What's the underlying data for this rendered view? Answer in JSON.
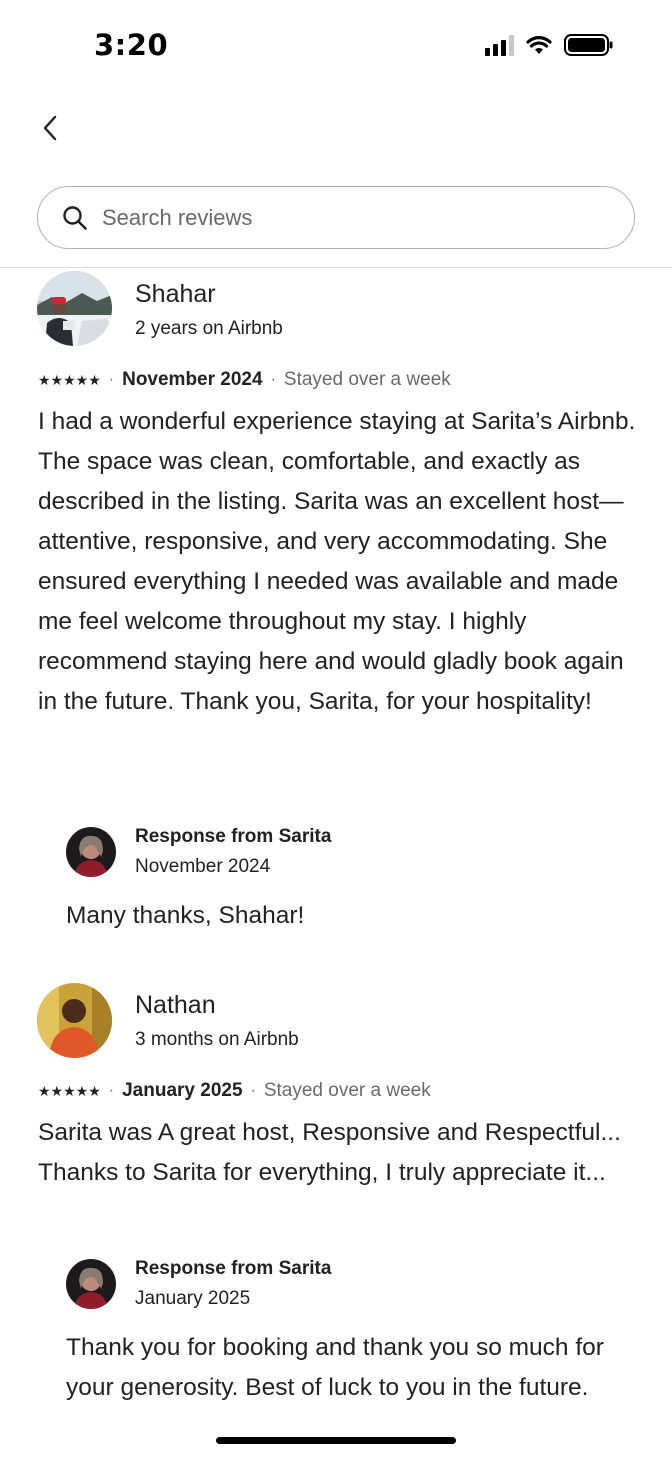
{
  "status_bar": {
    "time": "3:20"
  },
  "search": {
    "placeholder": "Search reviews"
  },
  "reviews": [
    {
      "name": "Shahar",
      "tenure": "2 years on Airbnb",
      "stars": "★★★★★",
      "date": "November 2024",
      "stay": "Stayed over a week",
      "text": "I had a wonderful experience staying at Sarita’s Airbnb. The space was clean, comfortable, and exactly as described in the listing. Sarita was an excellent host—attentive, responsive, and very accommodating. She ensured everything I needed was available and made me feel welcome throughout my stay. I highly recommend staying here and would gladly book again in the future. Thank you, Sarita, for your hospitality!",
      "response": {
        "title": "Response from Sarita",
        "date": "November 2024",
        "text": "Many thanks, Shahar!"
      }
    },
    {
      "name": "Nathan",
      "tenure": "3 months on Airbnb",
      "stars": "★★★★★",
      "date": "January 2025",
      "stay": "Stayed over a week",
      "text": "Sarita was A great host,  Responsive and Respectful... Thanks to Sarita for everything, I truly appreciate it...",
      "response": {
        "title": "Response from Sarita",
        "date": "January 2025",
        "text": "Thank you for booking and thank you so much for your generosity.  Best of luck to you in the future."
      }
    }
  ],
  "icons": {
    "back": "chevron-left-icon",
    "search": "search-icon",
    "signal": "cellular-signal-icon",
    "wifi": "wifi-icon",
    "battery": "battery-icon"
  }
}
